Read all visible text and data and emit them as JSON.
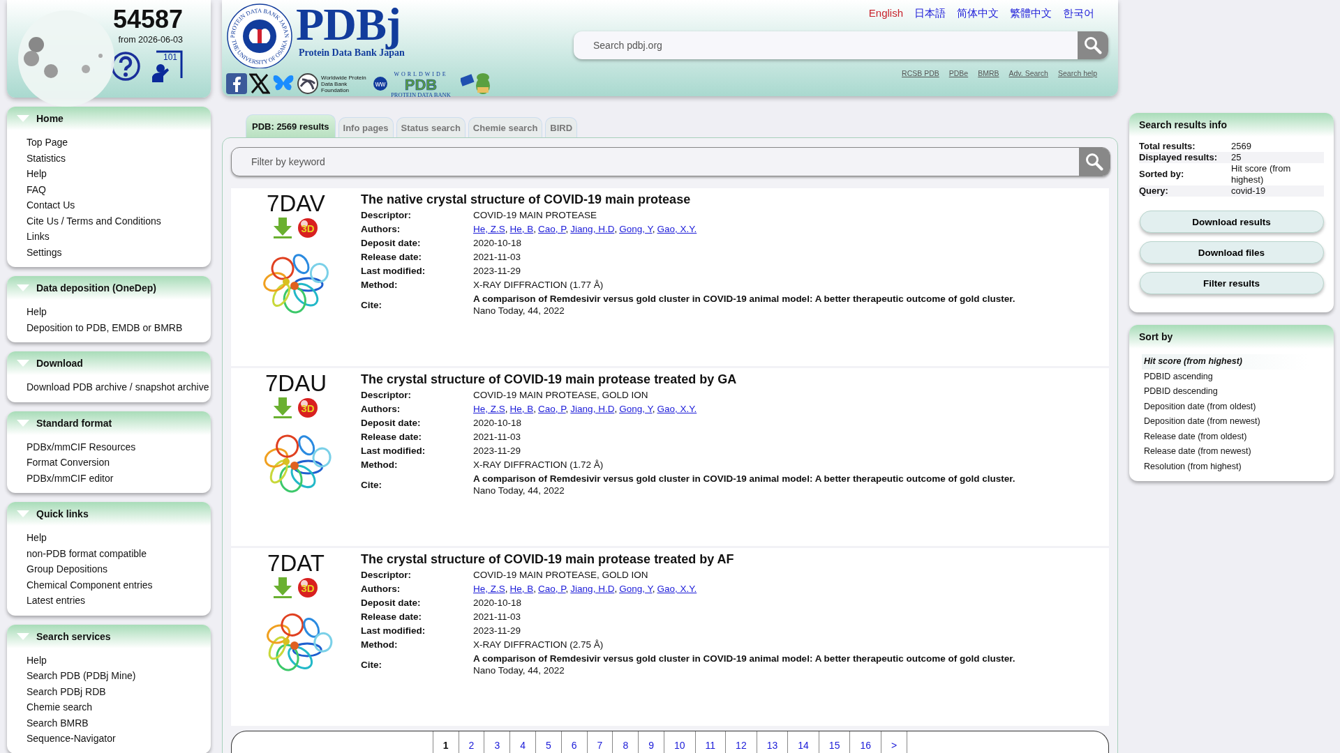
{
  "counter": {
    "number": "54587",
    "since": "from 2026-06-03",
    "tutorial_badge": "101"
  },
  "logo": {
    "ring_top": "PROTEIN DATA BANK JAPAN",
    "ring_bottom": "THE UNIVERSITY OF OSAKA",
    "title": "PDBj",
    "subtitle": "Protein Data Bank Japan"
  },
  "partners": {
    "foundation": "Worldwide Protein Data Bank Foundation",
    "wwpdb_top": "WORLDWIDE",
    "wwpdb_mark": "ww",
    "wwpdb_main": "PDB",
    "wwpdb_bottom": "PROTEIN DATA BANK"
  },
  "languages": [
    {
      "label": "English",
      "selected": true
    },
    {
      "label": "日本語",
      "selected": false
    },
    {
      "label": "简体中文",
      "selected": false
    },
    {
      "label": "繁體中文",
      "selected": false
    },
    {
      "label": "한국어",
      "selected": false
    }
  ],
  "search": {
    "placeholder": "Search pdbj.org"
  },
  "header_links": [
    "RCSB PDB",
    "PDBe",
    "BMRB",
    "Adv. Search",
    "Search help"
  ],
  "sidebar": [
    {
      "title": "Home",
      "expanded": true,
      "items": [
        "Top Page",
        "Statistics",
        "Help",
        "FAQ",
        "Contact Us",
        "Cite Us / Terms and Conditions",
        "Links",
        "Settings"
      ]
    },
    {
      "title": "Data deposition (OneDep)",
      "expanded": true,
      "items": [
        "Help",
        "Deposition to PDB, EMDB or BMRB"
      ]
    },
    {
      "title": "Download",
      "expanded": true,
      "items": [
        "Download PDB archive / snapshot archive"
      ]
    },
    {
      "title": "Standard format",
      "expanded": true,
      "items": [
        "PDBx/mmCIF Resources",
        "Format Conversion",
        "PDBx/mmCIF editor"
      ]
    },
    {
      "title": "Quick links",
      "expanded": true,
      "items": [
        "Help",
        "non-PDB format compatible",
        "Group Depositions",
        "Chemical Component entries",
        "Latest entries"
      ]
    },
    {
      "title": "Search services",
      "expanded": true,
      "items": [
        "Help",
        "Search PDB (PDBj Mine)",
        "Search PDBj RDB",
        "Chemie search",
        "Search BMRB",
        "Sequence-Navigator"
      ]
    }
  ],
  "tabs": [
    {
      "label": "PDB: 2569 results",
      "selected": true
    },
    {
      "label": "Info pages",
      "selected": false
    },
    {
      "label": "Status search",
      "selected": false
    },
    {
      "label": "Chemie search",
      "selected": false
    },
    {
      "label": "BIRD",
      "selected": false
    }
  ],
  "filter": {
    "placeholder": "Filter by keyword"
  },
  "results": [
    {
      "id": "7DAV",
      "viewer_label": "3D",
      "title": "The native crystal structure of COVID-19 main protease",
      "rows": [
        {
          "kind": "text",
          "label": "Descriptor:",
          "value": "COVID-19 MAIN PROTEASE"
        },
        {
          "kind": "authors",
          "label": "Authors:",
          "separator": ",",
          "authors": [
            "He, Z.S",
            "He, B",
            "Cao, P",
            "Jiang, H.D",
            "Gong, Y",
            "Gao, X.Y."
          ]
        },
        {
          "kind": "text",
          "label": "Deposit date:",
          "value": "2020-10-18"
        },
        {
          "kind": "text",
          "label": "Release date:",
          "value": "2021-11-03"
        },
        {
          "kind": "text",
          "label": "Last modified:",
          "value": "2023-11-29"
        },
        {
          "kind": "text",
          "label": "Method:",
          "value": "X-RAY DIFFRACTION (1.77 Å)"
        },
        {
          "kind": "cite",
          "label": "Cite:",
          "title": "A comparison of Remdesivir versus gold cluster in COVID-19 animal model: A better therapeutic outcome of gold cluster.",
          "journal": "Nano Today, 44, 2022"
        }
      ]
    },
    {
      "id": "7DAU",
      "viewer_label": "3D",
      "title": "The crystal structure of COVID-19 main protease treated by GA",
      "rows": [
        {
          "kind": "text",
          "label": "Descriptor:",
          "value": "COVID-19 MAIN PROTEASE, GOLD ION"
        },
        {
          "kind": "authors",
          "label": "Authors:",
          "separator": ",",
          "authors": [
            "He, Z.S",
            "He, B",
            "Cao, P",
            "Jiang, H.D",
            "Gong, Y",
            "Gao, X.Y."
          ]
        },
        {
          "kind": "text",
          "label": "Deposit date:",
          "value": "2020-10-18"
        },
        {
          "kind": "text",
          "label": "Release date:",
          "value": "2021-11-03"
        },
        {
          "kind": "text",
          "label": "Last modified:",
          "value": "2023-11-29"
        },
        {
          "kind": "text",
          "label": "Method:",
          "value": "X-RAY DIFFRACTION (1.72 Å)"
        },
        {
          "kind": "cite",
          "label": "Cite:",
          "title": "A comparison of Remdesivir versus gold cluster in COVID-19 animal model: A better therapeutic outcome of gold cluster.",
          "journal": "Nano Today, 44, 2022"
        }
      ]
    },
    {
      "id": "7DAT",
      "viewer_label": "3D",
      "title": "The crystal structure of COVID-19 main protease treated by AF",
      "rows": [
        {
          "kind": "text",
          "label": "Descriptor:",
          "value": "COVID-19 MAIN PROTEASE, GOLD ION"
        },
        {
          "kind": "authors",
          "label": "Authors:",
          "separator": ",",
          "authors": [
            "He, Z.S",
            "He, B",
            "Cao, P",
            "Jiang, H.D",
            "Gong, Y",
            "Gao, X.Y."
          ]
        },
        {
          "kind": "text",
          "label": "Deposit date:",
          "value": "2020-10-18"
        },
        {
          "kind": "text",
          "label": "Release date:",
          "value": "2021-11-03"
        },
        {
          "kind": "text",
          "label": "Last modified:",
          "value": "2023-11-29"
        },
        {
          "kind": "text",
          "label": "Method:",
          "value": "X-RAY DIFFRACTION (2.75 Å)"
        },
        {
          "kind": "cite",
          "label": "Cite:",
          "title": "A comparison of Remdesivir versus gold cluster in COVID-19 animal model: A better therapeutic outcome of gold cluster.",
          "journal": "Nano Today, 44, 2022"
        }
      ]
    }
  ],
  "info": {
    "title": "Search results info",
    "rows": [
      {
        "label": "Total results:",
        "value": "2569"
      },
      {
        "label": "Displayed results:",
        "value": "25"
      },
      {
        "label": "Sorted by:",
        "value": "Hit score (from highest)"
      },
      {
        "label": "Query:",
        "value": "covid-19"
      }
    ],
    "buttons": [
      "Download results",
      "Download files",
      "Filter results"
    ]
  },
  "sort": {
    "title": "Sort by",
    "options": [
      {
        "label": "Hit score (from highest)",
        "selected": true
      },
      {
        "label": "PDBID ascending",
        "selected": false
      },
      {
        "label": "PDBID descending",
        "selected": false
      },
      {
        "label": "Deposition date (from oldest)",
        "selected": false
      },
      {
        "label": "Deposition date (from newest)",
        "selected": false
      },
      {
        "label": "Release date (from oldest)",
        "selected": false
      },
      {
        "label": "Release date (from newest)",
        "selected": false
      },
      {
        "label": "Resolution (from highest)",
        "selected": false
      }
    ]
  },
  "pagination": {
    "pages": [
      {
        "label": "1",
        "selected": true
      },
      {
        "label": "2",
        "selected": false
      },
      {
        "label": "3",
        "selected": false
      },
      {
        "label": "4",
        "selected": false
      },
      {
        "label": "5",
        "selected": false
      },
      {
        "label": "6",
        "selected": false
      },
      {
        "label": "7",
        "selected": false
      },
      {
        "label": "8",
        "selected": false
      },
      {
        "label": "9",
        "selected": false
      },
      {
        "label": "10",
        "selected": false
      },
      {
        "label": "11",
        "selected": false
      },
      {
        "label": "12",
        "selected": false
      },
      {
        "label": "13",
        "selected": false
      },
      {
        "label": "14",
        "selected": false
      },
      {
        "label": "15",
        "selected": false
      },
      {
        "label": "16",
        "selected": false
      }
    ],
    "next": ">"
  }
}
